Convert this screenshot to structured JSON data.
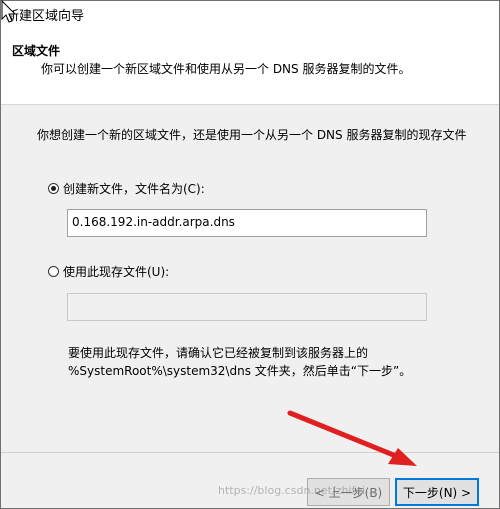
{
  "window": {
    "title": "新建区域向导"
  },
  "header": {
    "section_title": "区域文件",
    "description": "你可以创建一个新区域文件和使用从另一个 DNS 服务器复制的文件。"
  },
  "content": {
    "question": "你想创建一个新的区域文件，还是使用一个从另一个 DNS 服务器复制的现存文件",
    "option_create": {
      "label": "创建新文件，文件名为(C):",
      "selected": true,
      "value": "0.168.192.in-addr.arpa.dns"
    },
    "option_existing": {
      "label": "使用此现存文件(U):",
      "selected": false,
      "value": ""
    },
    "note_line1": "要使用此现存文件，请确认它已经被复制到该服务器上的",
    "note_line2": "%SystemRoot%\\system32\\dns 文件夹，然后单击“下一步”。"
  },
  "footer": {
    "back_label": "< 上一步(B)",
    "next_label": "下一步(N) >"
  },
  "watermark": "https://blog.csdn.net/zhifei...",
  "colors": {
    "annotation_arrow": "#e02020",
    "focus_border": "#0078d7"
  }
}
